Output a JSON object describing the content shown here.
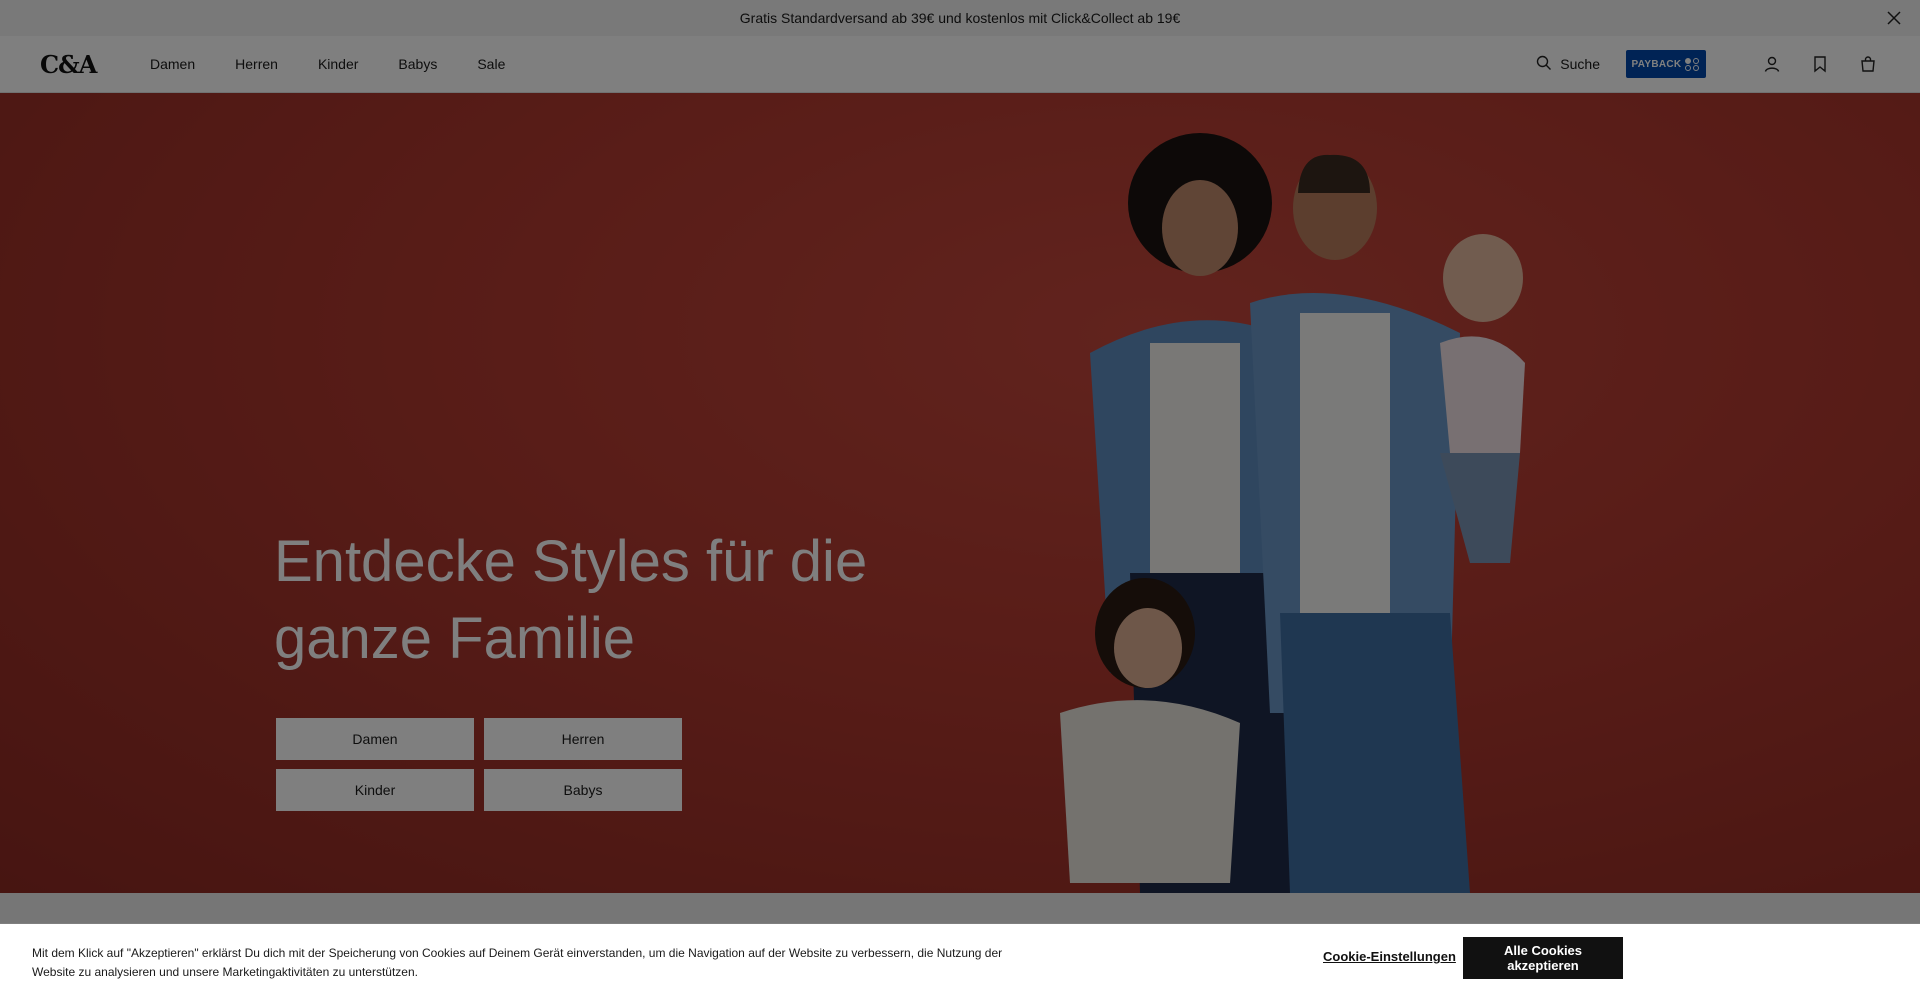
{
  "promo_bar": {
    "text": "Gratis Standardversand ab 39€ und kostenlos mit Click&Collect ab 19€"
  },
  "header": {
    "logo": "C&A",
    "nav": [
      {
        "label": "Damen"
      },
      {
        "label": "Herren"
      },
      {
        "label": "Kinder"
      },
      {
        "label": "Babys"
      },
      {
        "label": "Sale"
      }
    ],
    "search_label": "Suche",
    "payback_label": "PAYBACK"
  },
  "hero": {
    "title": "Entdecke Styles für die ganze Familie",
    "buttons": [
      {
        "label": "Damen"
      },
      {
        "label": "Herren"
      },
      {
        "label": "Kinder"
      },
      {
        "label": "Babys"
      }
    ]
  },
  "cookie_banner": {
    "text": "Mit dem Klick auf \"Akzeptieren\" erklärst Du dich mit der Speicherung von Cookies auf Deinem Gerät einverstanden, um die Navigation auf der Website zu verbessern, die Nutzung der Website zu analysieren und unsere Marketingaktivitäten zu unterstützen.",
    "settings_label": "Cookie-Einstellungen",
    "accept_label": "Alle Cookies akzeptieren"
  },
  "colors": {
    "hero_background": "#b23a30",
    "payback_blue": "#0046aa",
    "accept_button": "#111111"
  }
}
